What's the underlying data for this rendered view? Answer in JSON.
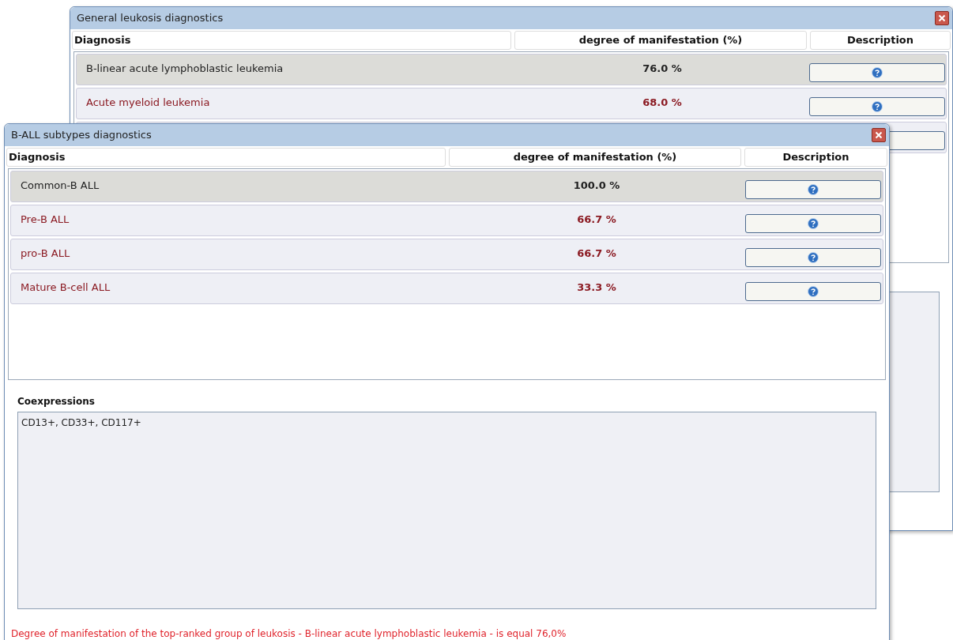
{
  "windows": [
    {
      "title": "General leukosis diagnostics",
      "columns": [
        "Diagnosis",
        "degree of manifestation (%)",
        "Description"
      ],
      "rows": [
        {
          "name": "B-linear acute lymphoblastic leukemia",
          "value": "76.0 %",
          "selected": true
        },
        {
          "name": "Acute myeloid leukemia",
          "value": "68.0 %",
          "selected": false
        },
        {
          "selected": false
        }
      ]
    },
    {
      "title": "B-ALL subtypes diagnostics",
      "columns": [
        "Diagnosis",
        "degree of manifestation (%)",
        "Description"
      ],
      "rows": [
        {
          "name": "Common-B ALL",
          "value": "100.0 %",
          "selected": true
        },
        {
          "name": "Pre-B ALL",
          "value": "66.7 %",
          "selected": false
        },
        {
          "name": "pro-B ALL",
          "value": "66.7 %",
          "selected": false
        },
        {
          "name": "Mature B-cell ALL",
          "value": "33.3 %",
          "selected": false
        }
      ],
      "coexpressions": {
        "label": "Coexpressions",
        "value": "CD13+, CD33+, CD117+"
      },
      "status": "Degree of manifestation of the top-ranked group of leukosis - B-linear acute lymphoblastic leukemia - is equal 76,0%"
    }
  ]
}
